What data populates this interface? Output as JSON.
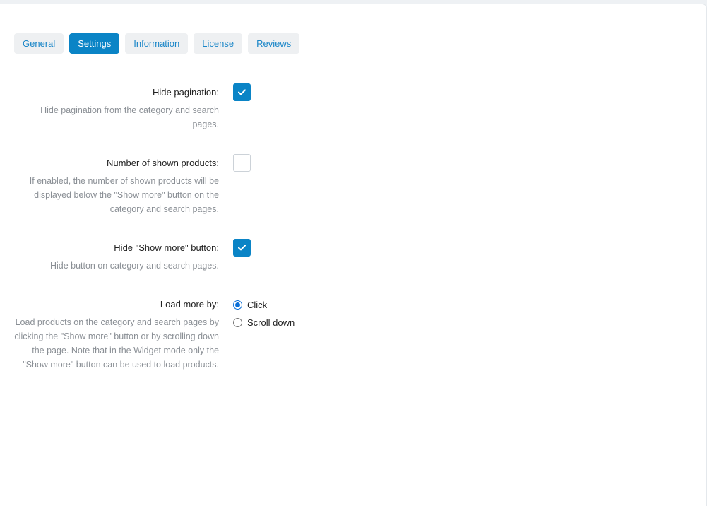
{
  "tabs": [
    {
      "label": "General",
      "active": false
    },
    {
      "label": "Settings",
      "active": true
    },
    {
      "label": "Information",
      "active": false
    },
    {
      "label": "License",
      "active": false
    },
    {
      "label": "Reviews",
      "active": false
    }
  ],
  "settings": {
    "hide_pagination": {
      "label": "Hide pagination:",
      "help": "Hide pagination from the category and search pages.",
      "checked": true
    },
    "number_shown": {
      "label": "Number of shown products:",
      "help": "If enabled, the number of shown products will be displayed below the \"Show more\" button on the category and search pages.",
      "checked": false
    },
    "hide_show_more": {
      "label": "Hide \"Show more\" button:",
      "help": "Hide button on category and search pages.",
      "checked": true
    },
    "load_more_by": {
      "label": "Load more by:",
      "help": "Load products on the category and search pages by clicking the \"Show more\" button or by scrolling down the page. Note that in the Widget mode only the \"Show more\" button can be used to load products.",
      "options": [
        {
          "label": "Click",
          "checked": true
        },
        {
          "label": "Scroll down",
          "checked": false
        }
      ]
    }
  },
  "colors": {
    "accent": "#0a84c6",
    "tab_text": "#1a86c8",
    "help_text": "#8a8f95"
  }
}
